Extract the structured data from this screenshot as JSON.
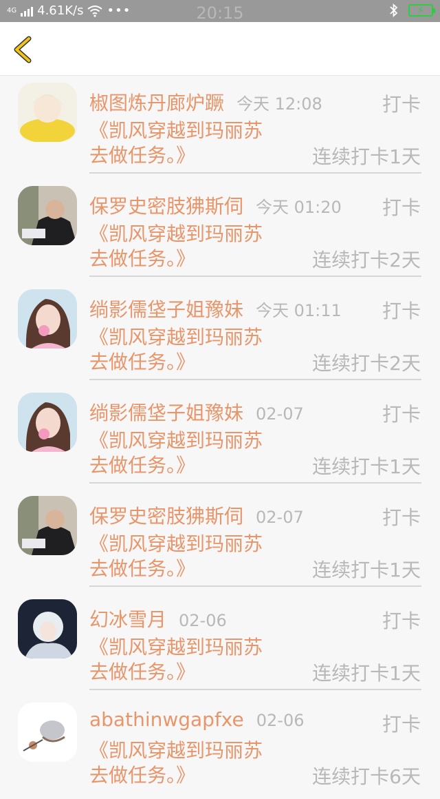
{
  "status_bar": {
    "network": "4G",
    "speed": "4.61K/s",
    "time": "20:15"
  },
  "nav": {
    "back_icon": "chevron-left-icon",
    "back_color": "#f0c419"
  },
  "items": [
    {
      "name": "椒图炼丹廊炉蹶",
      "time": "今天 12:08",
      "action": "打卡",
      "content_line1": "《凯风穿越到玛丽苏",
      "content_line2": "去做任务。》",
      "streak": "连续打卡1天",
      "avatar_style": "yellow-scarf"
    },
    {
      "name": "保罗史密肢狒斯伺",
      "time": "今天 01:20",
      "action": "打卡",
      "content_line1": "《凯风穿越到玛丽苏",
      "content_line2": "去做任务。》",
      "streak": "连续打卡2天",
      "avatar_style": "suit-man"
    },
    {
      "name": "绱影儒垡子姐豫妹",
      "time": "今天 01:11",
      "action": "打卡",
      "content_line1": "《凯风穿越到玛丽苏",
      "content_line2": "去做任务。》",
      "streak": "连续打卡2天",
      "avatar_style": "bubble-girl"
    },
    {
      "name": "绱影儒垡子姐豫妹",
      "time": "02-07",
      "action": "打卡",
      "content_line1": "《凯风穿越到玛丽苏",
      "content_line2": "去做任务。》",
      "streak": "连续打卡1天",
      "avatar_style": "bubble-girl"
    },
    {
      "name": "保罗史密肢狒斯伺",
      "time": "02-07",
      "action": "打卡",
      "content_line1": "《凯风穿越到玛丽苏",
      "content_line2": "去做任务。》",
      "streak": "连续打卡1天",
      "avatar_style": "suit-man"
    },
    {
      "name": "幻冰雪月",
      "time": "02-06",
      "action": "打卡",
      "content_line1": "《凯风穿越到玛丽苏",
      "content_line2": "去做任务。》",
      "streak": "连续打卡1天",
      "avatar_style": "white-hair-dark"
    },
    {
      "name": "abathinwgapfxe",
      "time": "02-06",
      "action": "打卡",
      "content_line1": "《凯风穿越到玛丽苏",
      "content_line2": "去做任务。》",
      "streak": "连续打卡6天",
      "avatar_style": "bird-sketch"
    }
  ],
  "colors": {
    "accent": "#e8956a",
    "muted": "#b8b8b8",
    "status_bar": "#999999",
    "battery": "#2ecc40"
  }
}
